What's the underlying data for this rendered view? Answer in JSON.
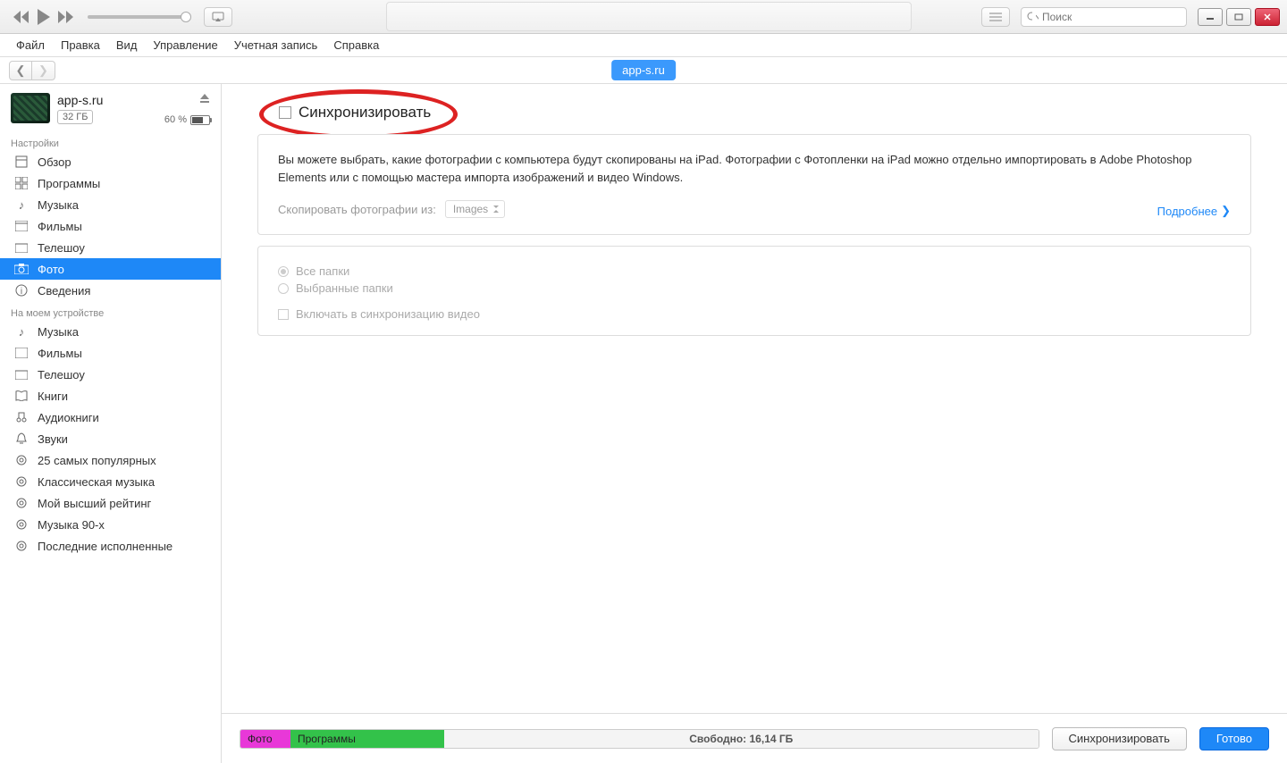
{
  "search": {
    "placeholder": "Поиск"
  },
  "menu": {
    "file": "Файл",
    "edit": "Правка",
    "view": "Вид",
    "controls": "Управление",
    "account": "Учетная запись",
    "help": "Справка"
  },
  "breadcrumb": "app-s.ru",
  "device": {
    "name": "app-s.ru",
    "capacity": "32 ГБ",
    "battery_pct": "60 %"
  },
  "sidebar": {
    "section_settings": "Настройки",
    "section_on_device": "На моем устройстве",
    "settings": [
      {
        "label": "Обзор"
      },
      {
        "label": "Программы"
      },
      {
        "label": "Музыка"
      },
      {
        "label": "Фильмы"
      },
      {
        "label": "Телешоу"
      },
      {
        "label": "Фото"
      },
      {
        "label": "Сведения"
      }
    ],
    "on_device": [
      {
        "label": "Музыка"
      },
      {
        "label": "Фильмы"
      },
      {
        "label": "Телешоу"
      },
      {
        "label": "Книги"
      },
      {
        "label": "Аудиокниги"
      },
      {
        "label": "Звуки"
      },
      {
        "label": "25 самых популярных"
      },
      {
        "label": "Классическая музыка"
      },
      {
        "label": "Мой высший рейтинг"
      },
      {
        "label": "Музыка 90-х"
      },
      {
        "label": "Последние исполненные"
      }
    ]
  },
  "content": {
    "sync_label": "Синхронизировать",
    "info_text": "Вы можете выбрать, какие фотографии с компьютера будут скопированы на iPad. Фотографии с Фотопленки на iPad можно отдельно импортировать в Adobe Photoshop Elements или с помощью мастера импорта изображений и видео Windows.",
    "copy_from_label": "Скопировать фотографии из:",
    "copy_from_value": "Images",
    "more_link": "Подробнее",
    "opt_all": "Все папки",
    "opt_selected": "Выбранные папки",
    "opt_include_video": "Включать в синхронизацию видео"
  },
  "bottom": {
    "seg_photo": "Фото",
    "seg_apps": "Программы",
    "free": "Свободно: 16,14 ГБ",
    "sync_btn": "Синхронизировать",
    "done_btn": "Готово"
  }
}
